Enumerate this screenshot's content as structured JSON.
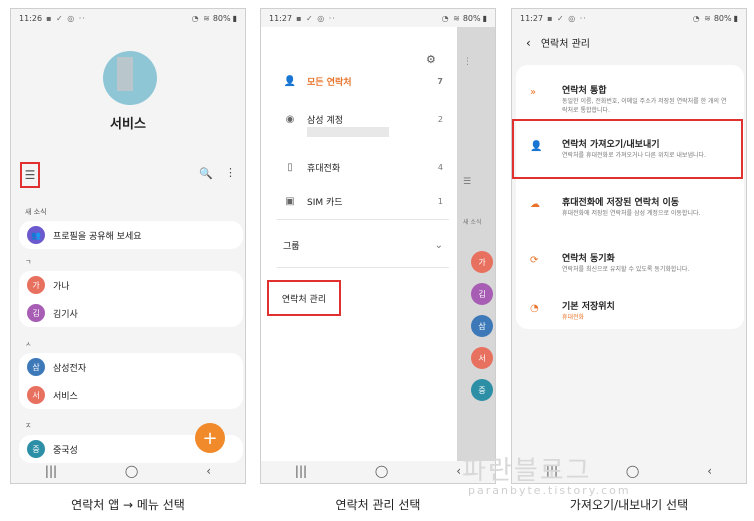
{
  "screen1": {
    "status_time": "11:26",
    "battery": "80%",
    "profile_name": "서비스",
    "section_news": "새 소식",
    "news_item": "프로필을 공유해 보세요",
    "group_g": "ㄱ",
    "group_s": "ㅅ",
    "group_j": "ㅈ",
    "contacts_g": [
      {
        "initial": "가",
        "name": "가나",
        "color": "#e8705f"
      },
      {
        "initial": "김",
        "name": "김기사",
        "color": "#a65db3"
      }
    ],
    "contacts_s": [
      {
        "initial": "삼",
        "name": "삼성전자",
        "color": "#3d79b8"
      },
      {
        "initial": "서",
        "name": "서비스",
        "color": "#e8705f"
      }
    ],
    "contacts_j": [
      {
        "initial": "중",
        "name": "중국성",
        "color": "#2d8fa6"
      }
    ],
    "fab_label": "+"
  },
  "screen2": {
    "status_time": "11:27",
    "battery": "80%",
    "items": [
      {
        "label": "모든 연락처",
        "count": "7"
      },
      {
        "label": "삼성 계정",
        "count": "2"
      },
      {
        "label": "휴대전화",
        "count": "4"
      },
      {
        "label": "SIM 카드",
        "count": "1"
      }
    ],
    "group_label": "그룹",
    "manage_label": "연락처 관리",
    "peek_section": "새 소식",
    "peek_badges": [
      {
        "initial": "가",
        "color": "#e8705f"
      },
      {
        "initial": "김",
        "color": "#a65db3"
      },
      {
        "initial": "삼",
        "color": "#3d79b8"
      },
      {
        "initial": "서",
        "color": "#e8705f"
      },
      {
        "initial": "중",
        "color": "#2d8fa6"
      }
    ]
  },
  "screen3": {
    "status_time": "11:27",
    "battery": "80%",
    "title": "연락처 관리",
    "options": [
      {
        "title": "연락처 통합",
        "desc": "동일한 이름, 전화번호, 이메일 주소가 저장된 연락처를 한 개의 연락처로 통합합니다."
      },
      {
        "title": "연락처 가져오기/내보내기",
        "desc": "연락처를 휴대전화로 가져오거나 다른 위치로 내보냅니다."
      },
      {
        "title": "휴대전화에 저장된 연락처 이동",
        "desc": "휴대전화에 저장된 연락처를 삼성 계정으로 이동합니다."
      },
      {
        "title": "연락처 동기화",
        "desc": "연락처를 최신으로 유지할 수 있도록 동기화합니다."
      },
      {
        "title": "기본 저장위치",
        "desc": "휴대전화"
      }
    ]
  },
  "captions": {
    "c1": "연락처 앱 → 메뉴 선택",
    "c2": "연락처 관리 선택",
    "c3": "가져오기/내보내기 선택"
  },
  "watermark": {
    "main": "파란블로그",
    "url": "paranbyte.tistory.com"
  }
}
